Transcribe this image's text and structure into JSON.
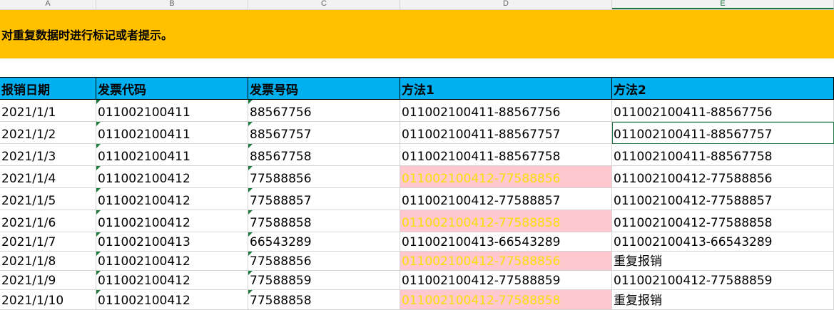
{
  "column_headers": [
    "A",
    "B",
    "C",
    "D",
    "E"
  ],
  "banner": {
    "text": "对重复数据时进行标记或者提示。"
  },
  "table": {
    "headers": [
      "报销日期",
      "发票代码",
      "发票号码",
      "方法1",
      "方法2"
    ],
    "rows": [
      {
        "date": "2021/1/1",
        "code": "011002100411",
        "number": "88567756",
        "m1": "011002100411-88567756",
        "m1_dup": false,
        "m2": "011002100411-88567756"
      },
      {
        "date": "2021/1/2",
        "code": "011002100411",
        "number": "88567757",
        "m1": "011002100411-88567757",
        "m1_dup": false,
        "m2": "011002100411-88567757"
      },
      {
        "date": "2021/1/3",
        "code": "011002100411",
        "number": "88567758",
        "m1": "011002100411-88567758",
        "m1_dup": false,
        "m2": "011002100411-88567758"
      },
      {
        "date": "2021/1/4",
        "code": "011002100412",
        "number": "77588856",
        "m1": "011002100412-77588856",
        "m1_dup": true,
        "m2": "011002100412-77588856"
      },
      {
        "date": "2021/1/5",
        "code": "011002100412",
        "number": "77588857",
        "m1": "011002100412-77588857",
        "m1_dup": false,
        "m2": "011002100412-77588857"
      },
      {
        "date": "2021/1/6",
        "code": "011002100412",
        "number": "77588858",
        "m1": "011002100412-77588858",
        "m1_dup": true,
        "m2": "011002100412-77588858"
      },
      {
        "date": "2021/1/7",
        "code": "011002100413",
        "number": "66543289",
        "m1": "011002100413-66543289",
        "m1_dup": false,
        "m2": "011002100413-66543289"
      },
      {
        "date": "2021/1/8",
        "code": "011002100412",
        "number": "77588856",
        "m1": "011002100412-77588856",
        "m1_dup": true,
        "m2": "重复报销"
      },
      {
        "date": "2021/1/9",
        "code": "011002100412",
        "number": "77588859",
        "m1": "011002100412-77588859",
        "m1_dup": false,
        "m2": "011002100412-77588859"
      },
      {
        "date": "2021/1/10",
        "code": "011002100412",
        "number": "77588858",
        "m1": "011002100412-77588858",
        "m1_dup": true,
        "m2": "重复报销"
      }
    ]
  },
  "colors": {
    "banner": "#ffc000",
    "header_fill": "#00b0f0",
    "duplicate_fill": "#ffc7ce",
    "duplicate_text": "#f5e10a",
    "selection": "#217346"
  }
}
